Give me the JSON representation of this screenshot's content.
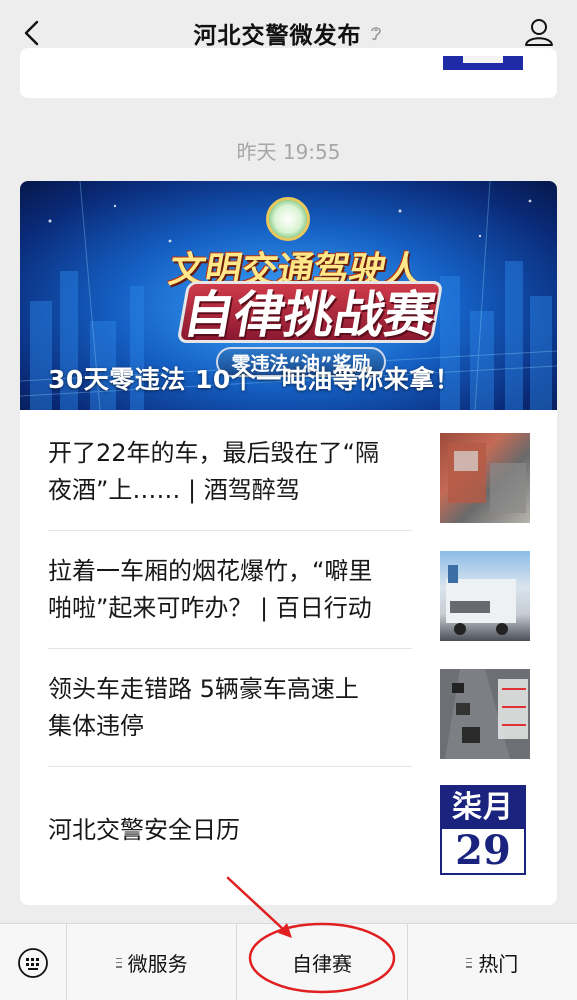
{
  "header": {
    "title": "河北交警微发布",
    "back_icon": "chevron-left-icon",
    "ear_icon": "ear-icon",
    "profile_icon": "person-icon"
  },
  "timestamp": "昨天 19:55",
  "banner": {
    "logo_line1": "文明交通驾驶人",
    "logo_line2": "自律挑战赛",
    "logo_line3": "零违法“油”奖励",
    "caption": "30天零违法 10个一吨油等你来拿！"
  },
  "articles": [
    {
      "line1": "开了22年的车，最后毁在了“隔",
      "line2": "夜酒”上…… | 酒驾醉驾"
    },
    {
      "line1": "拉着一车厢的烟花爆竹，“噼里",
      "line2": "啪啦”起来可咋办？ | 百日行动"
    },
    {
      "line1": "领头车走错路 5辆豪车高速上",
      "line2": "集体违停"
    },
    {
      "line1": "河北交警安全日历",
      "line2": ""
    }
  ],
  "calendar": {
    "month": "柒月",
    "day": "29"
  },
  "bottom_menu": {
    "keyboard_icon": "keyboard-icon",
    "items": [
      {
        "label": "微服务",
        "has_submenu": true
      },
      {
        "label": "自律赛",
        "has_submenu": false
      },
      {
        "label": "热门",
        "has_submenu": true
      }
    ]
  },
  "colors": {
    "background": "#ededed",
    "annotation_red": "#e02020",
    "calendar_blue": "#1a237e"
  }
}
